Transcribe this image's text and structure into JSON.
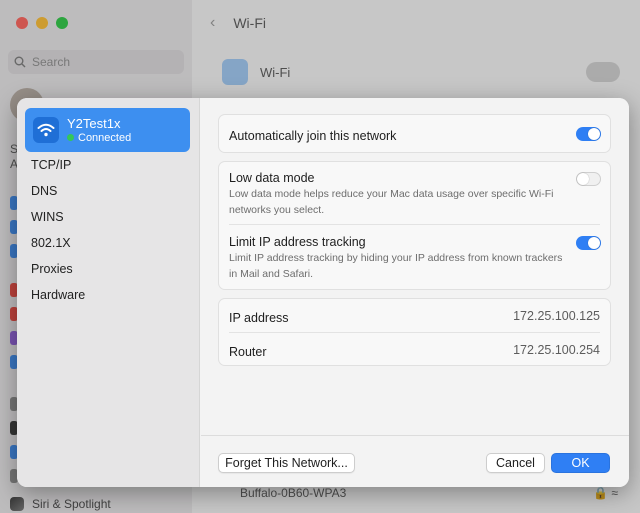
{
  "background": {
    "search_placeholder": "Search",
    "header_title": "Wi-Fi",
    "wifi_row_label": "Wi-Fi",
    "sidebar_bottom_item": "Siri & Spotlight",
    "visible_network": "Buffalo-0B60-WPA3",
    "sidebar_letters": [
      "S",
      "A"
    ]
  },
  "sheet": {
    "network": {
      "name": "Y2Test1x",
      "status": "Connected"
    },
    "sidebar_items": [
      "TCP/IP",
      "DNS",
      "WINS",
      "802.1X",
      "Proxies",
      "Hardware"
    ],
    "auto_join": {
      "label": "Automatically join this network",
      "enabled": true
    },
    "low_data_mode": {
      "label": "Low data mode",
      "description": "Low data mode helps reduce your Mac data usage over specific Wi-Fi networks you select.",
      "enabled": false
    },
    "limit_ip_tracking": {
      "label": "Limit IP address tracking",
      "description": "Limit IP address tracking by hiding your IP address from known trackers in Mail and Safari.",
      "enabled": true
    },
    "ip_address": {
      "label": "IP address",
      "value": "172.25.100.125"
    },
    "router": {
      "label": "Router",
      "value": "172.25.100.254"
    },
    "buttons": {
      "forget": "Forget This Network...",
      "cancel": "Cancel",
      "ok": "OK"
    }
  },
  "colors": {
    "accent": "#2f7ff4",
    "selected_row": "#3d8ff0",
    "connected_dot": "#34c759"
  }
}
